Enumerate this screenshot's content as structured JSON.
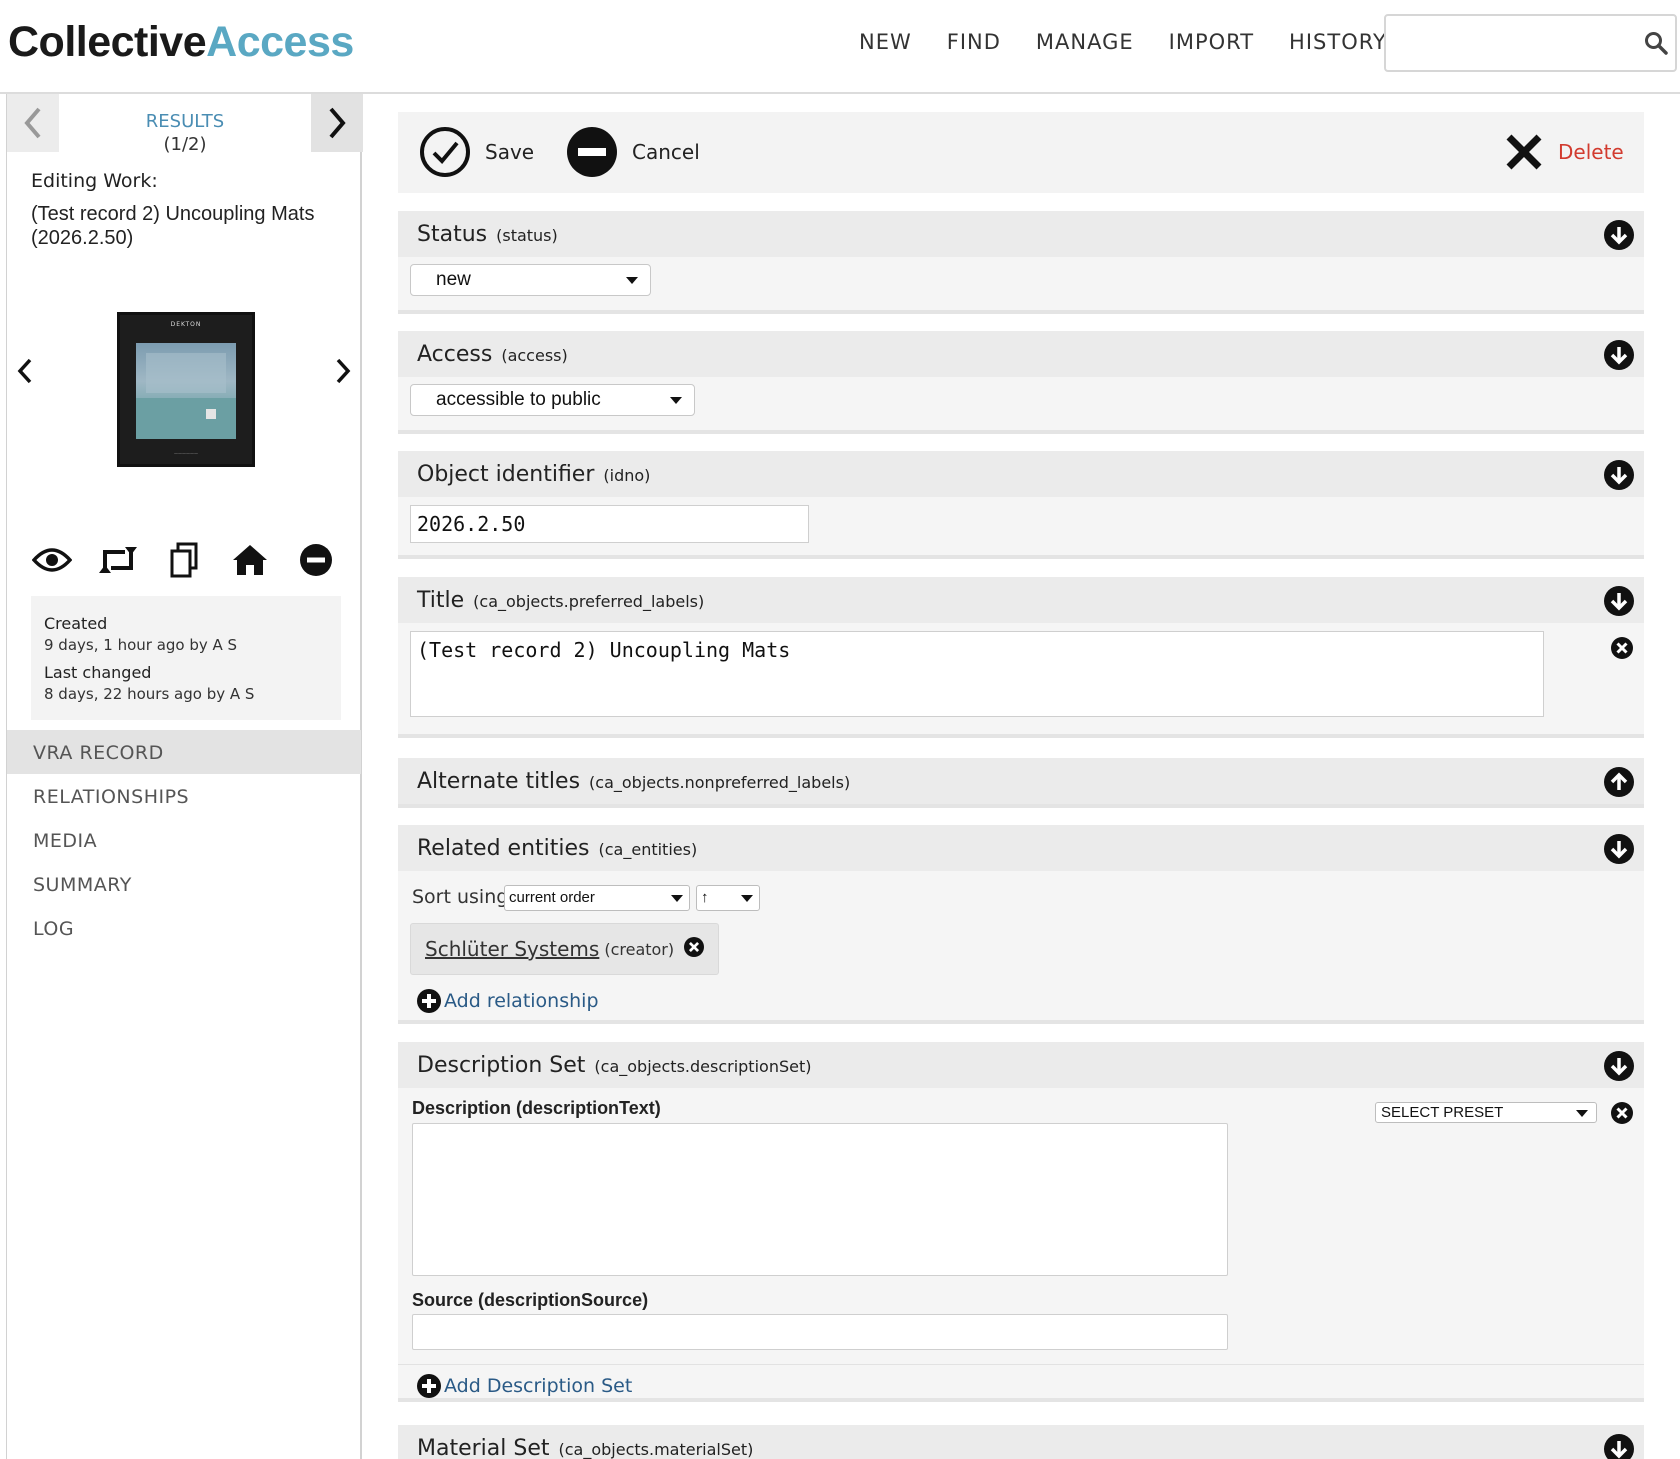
{
  "header": {
    "logo_part1": "Collective",
    "logo_part2": "Access",
    "nav": [
      "NEW",
      "FIND",
      "MANAGE",
      "IMPORT",
      "HISTORY"
    ],
    "search_value": ""
  },
  "sidebar": {
    "results_label": "RESULTS",
    "results_count": "(1/2)",
    "editing_label": "Editing Work:",
    "editing_title": "(Test record 2) Uncoupling Mats (2026.2.50)",
    "thumb_logo": "DEKTON",
    "created_label": "Created",
    "created_value": "9 days, 1 hour ago by A S",
    "changed_label": "Last changed",
    "changed_value": "8 days, 22 hours ago by A S",
    "nav": [
      "VRA RECORD",
      "RELATIONSHIPS",
      "MEDIA",
      "SUMMARY",
      "LOG"
    ],
    "active_nav": "VRA RECORD"
  },
  "toolbar": {
    "save_label": "Save",
    "cancel_label": "Cancel",
    "delete_label": "Delete"
  },
  "bundles": {
    "status": {
      "title": "Status",
      "code": "(status)",
      "value": "new"
    },
    "access": {
      "title": "Access",
      "code": "(access)",
      "value": "accessible to public"
    },
    "idno": {
      "title": "Object identifier",
      "code": "(idno)",
      "value": "2026.2.50"
    },
    "title": {
      "title": "Title",
      "code": "(ca_objects.preferred_labels)",
      "value": "(Test record 2) Uncoupling Mats"
    },
    "alt_titles": {
      "title": "Alternate titles",
      "code": "(ca_objects.nonpreferred_labels)"
    },
    "entities": {
      "title": "Related entities",
      "code": "(ca_entities)",
      "sort_label": "Sort using",
      "sort_value": "current order",
      "sort_dir": "↑",
      "relation_name": "Schlüter Systems",
      "relation_type": "(creator)",
      "add_label": "Add relationship"
    },
    "description_set": {
      "title": "Description Set",
      "code": "(ca_objects.descriptionSet)",
      "desc_label": "Description",
      "desc_code": "(descriptionText)",
      "preset_value": "SELECT PRESET",
      "source_label": "Source",
      "source_code": "(descriptionSource)",
      "add_label": "Add Description Set"
    },
    "material_set": {
      "title": "Material Set",
      "code": "(ca_objects.materialSet)"
    }
  },
  "colors": {
    "logo_accent": "#5aa8c3",
    "delete_red": "#d23b2f",
    "link_blue": "#2a5a86",
    "results_blue": "#4a8db3"
  }
}
